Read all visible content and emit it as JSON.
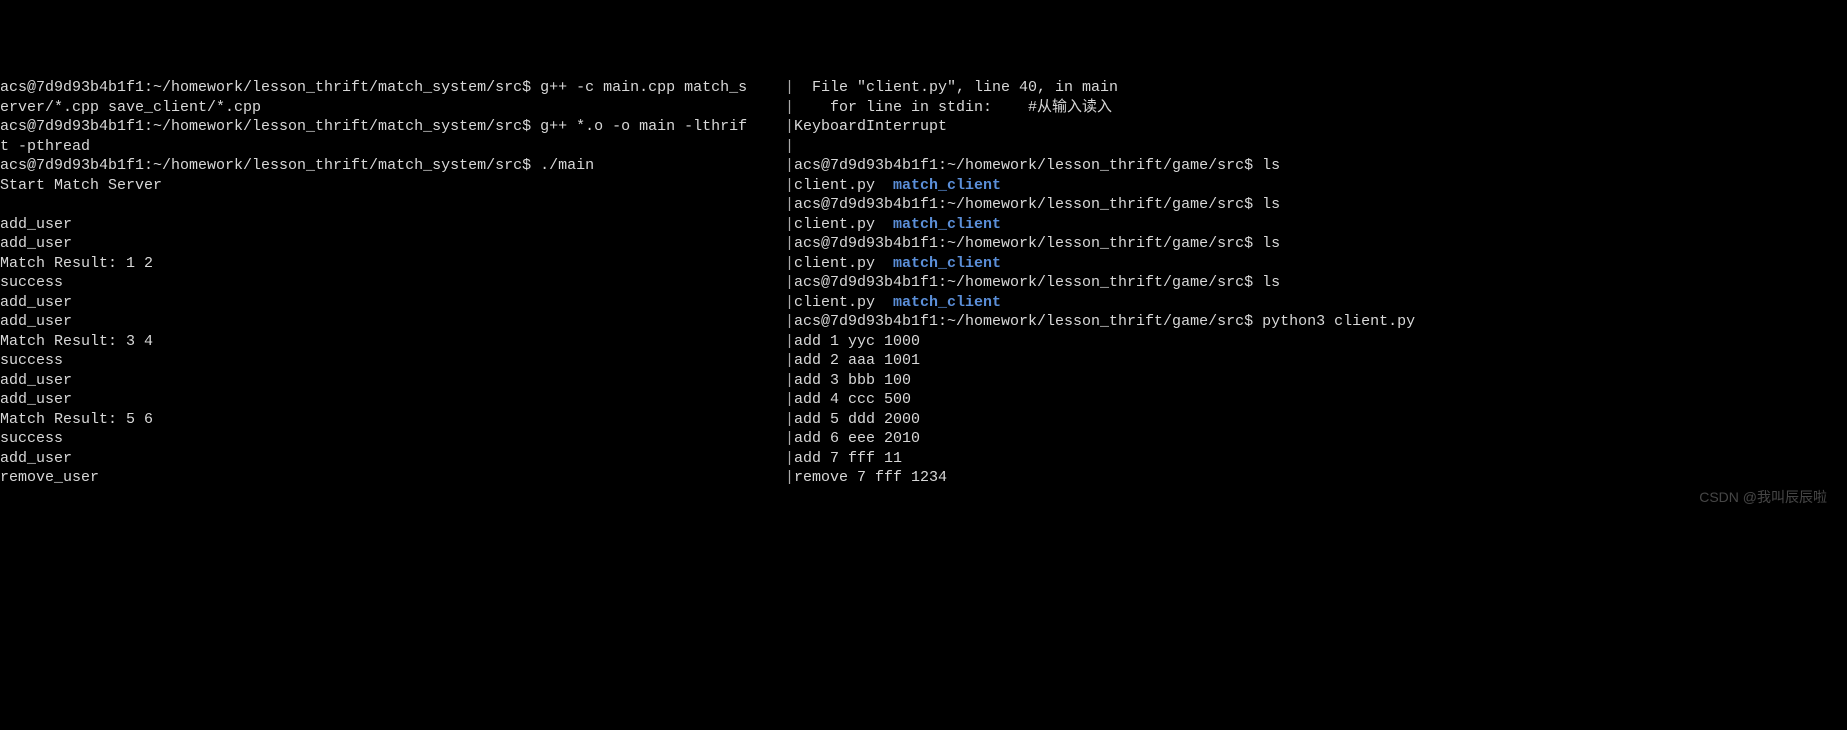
{
  "left_pane": {
    "lines": [
      {
        "text": "acs@7d9d93b4b1f1:~/homework/lesson_thrift/match_system/src$ g++ -c main.cpp match_s",
        "type": "plain"
      },
      {
        "text": "erver/*.cpp save_client/*.cpp",
        "type": "plain"
      },
      {
        "text": "acs@7d9d93b4b1f1:~/homework/lesson_thrift/match_system/src$ g++ *.o -o main -lthrif",
        "type": "plain"
      },
      {
        "text": "t -pthread",
        "type": "plain"
      },
      {
        "text": "acs@7d9d93b4b1f1:~/homework/lesson_thrift/match_system/src$ ./main",
        "type": "plain"
      },
      {
        "text": "Start Match Server",
        "type": "plain"
      },
      {
        "text": "",
        "type": "plain"
      },
      {
        "text": "add_user",
        "type": "plain"
      },
      {
        "text": "add_user",
        "type": "plain"
      },
      {
        "text": "Match Result: 1 2",
        "type": "plain"
      },
      {
        "text": "success",
        "type": "plain"
      },
      {
        "text": "add_user",
        "type": "plain"
      },
      {
        "text": "add_user",
        "type": "plain"
      },
      {
        "text": "Match Result: 3 4",
        "type": "plain"
      },
      {
        "text": "success",
        "type": "plain"
      },
      {
        "text": "add_user",
        "type": "plain"
      },
      {
        "text": "add_user",
        "type": "plain"
      },
      {
        "text": "Match Result: 5 6",
        "type": "plain"
      },
      {
        "text": "success",
        "type": "plain"
      },
      {
        "text": "add_user",
        "type": "plain"
      },
      {
        "text": "remove_user",
        "type": "plain"
      }
    ]
  },
  "right_pane": {
    "lines": [
      {
        "text": "  File \"client.py\", line 40, in main",
        "type": "plain"
      },
      {
        "text": "    for line in stdin:    #从输入读入",
        "type": "plain"
      },
      {
        "text": "KeyboardInterrupt",
        "type": "plain"
      },
      {
        "text": "",
        "type": "plain"
      },
      {
        "text": "acs@7d9d93b4b1f1:~/homework/lesson_thrift/game/src$ ls",
        "type": "plain"
      },
      {
        "prefix": "client.py  ",
        "dir": "match_client",
        "type": "ls"
      },
      {
        "text": "acs@7d9d93b4b1f1:~/homework/lesson_thrift/game/src$ ls",
        "type": "plain"
      },
      {
        "prefix": "client.py  ",
        "dir": "match_client",
        "type": "ls"
      },
      {
        "text": "acs@7d9d93b4b1f1:~/homework/lesson_thrift/game/src$ ls",
        "type": "plain"
      },
      {
        "prefix": "client.py  ",
        "dir": "match_client",
        "type": "ls"
      },
      {
        "text": "acs@7d9d93b4b1f1:~/homework/lesson_thrift/game/src$ ls",
        "type": "plain"
      },
      {
        "prefix": "client.py  ",
        "dir": "match_client",
        "type": "ls"
      },
      {
        "text": "acs@7d9d93b4b1f1:~/homework/lesson_thrift/game/src$ python3 client.py",
        "type": "plain"
      },
      {
        "text": "add 1 yyc 1000",
        "type": "plain"
      },
      {
        "text": "add 2 aaa 1001",
        "type": "plain"
      },
      {
        "text": "add 3 bbb 100",
        "type": "plain"
      },
      {
        "text": "add 4 ccc 500",
        "type": "plain"
      },
      {
        "text": "add 5 ddd 2000",
        "type": "plain"
      },
      {
        "text": "add 6 eee 2010",
        "type": "plain"
      },
      {
        "text": "add 7 fff 11",
        "type": "plain"
      },
      {
        "text": "remove 7 fff 1234",
        "type": "plain"
      }
    ]
  },
  "watermark": "CSDN @我叫辰辰啦"
}
